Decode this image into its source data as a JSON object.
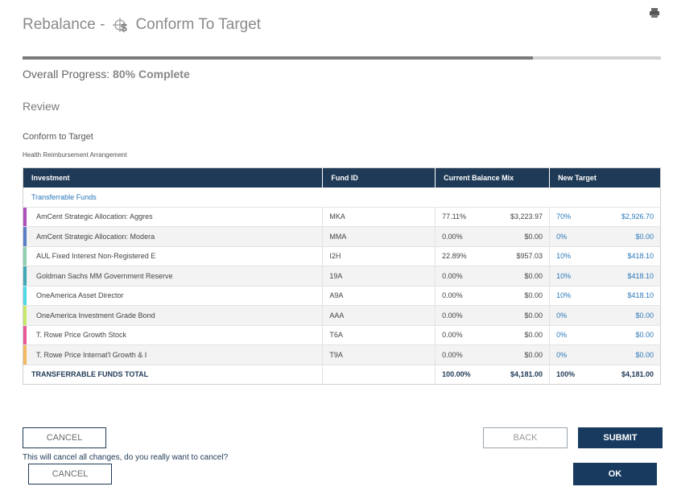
{
  "header": {
    "title_prefix": "Rebalance -",
    "title_main": "Conform To Target"
  },
  "progress": {
    "label": "Overall Progress:",
    "percent_text": "80%",
    "complete_text": "Complete",
    "fraction": 0.8
  },
  "section": {
    "review": "Review",
    "conform": "Conform to Target",
    "plan": "Health Reimbursement Arrangement"
  },
  "table": {
    "headers": [
      "Investment",
      "Fund ID",
      "Current Balance Mix",
      "New Target"
    ],
    "group_label": "Transferrable Funds",
    "rows": [
      {
        "name": "AmCent Strategic Allocation: Aggres",
        "fund": "MKA",
        "cur_pct": "77.11%",
        "cur_amt": "$3,223.97",
        "new_pct": "70%",
        "new_amt": "$2,926.70",
        "color": "#b04fbf"
      },
      {
        "name": "AmCent Strategic Allocation: Modera",
        "fund": "MMA",
        "cur_pct": "0.00%",
        "cur_amt": "$0.00",
        "new_pct": "0%",
        "new_amt": "$0.00",
        "color": "#5b7fc6"
      },
      {
        "name": "AUL Fixed Interest Non-Registered E",
        "fund": "I2H",
        "cur_pct": "22.89%",
        "cur_amt": "$957.03",
        "new_pct": "10%",
        "new_amt": "$418.10",
        "color": "#8fd0b0"
      },
      {
        "name": "Goldman Sachs MM Government Reserve",
        "fund": "19A",
        "cur_pct": "0.00%",
        "cur_amt": "$0.00",
        "new_pct": "10%",
        "new_amt": "$418.10",
        "color": "#3fa9b5"
      },
      {
        "name": "OneAmerica Asset Director",
        "fund": "A9A",
        "cur_pct": "0.00%",
        "cur_amt": "$0.00",
        "new_pct": "10%",
        "new_amt": "$418.10",
        "color": "#4fd8e8"
      },
      {
        "name": "OneAmerica Investment Grade Bond",
        "fund": "AAA",
        "cur_pct": "0.00%",
        "cur_amt": "$0.00",
        "new_pct": "0%",
        "new_amt": "$0.00",
        "color": "#c8e86a"
      },
      {
        "name": "T. Rowe Price Growth Stock",
        "fund": "T6A",
        "cur_pct": "0.00%",
        "cur_amt": "$0.00",
        "new_pct": "0%",
        "new_amt": "$0.00",
        "color": "#e85a9a"
      },
      {
        "name": "T. Rowe Price Internat'l Growth & I",
        "fund": "T9A",
        "cur_pct": "0.00%",
        "cur_amt": "$0.00",
        "new_pct": "0%",
        "new_amt": "$0.00",
        "color": "#f4b860"
      }
    ],
    "total": {
      "label": "TRANSFERRABLE FUNDS TOTAL",
      "cur_pct": "100.00%",
      "cur_amt": "$4,181.00",
      "new_pct": "100%",
      "new_amt": "$4,181.00"
    }
  },
  "buttons": {
    "cancel": "CANCEL",
    "back": "BACK",
    "submit": "SUBMIT",
    "cancel_confirm": "CANCEL",
    "ok": "OK"
  },
  "cancel_note": "This will cancel all changes, do you really want to cancel?",
  "colors": {
    "accent": "#1f3a56",
    "link": "#2a77b8"
  }
}
